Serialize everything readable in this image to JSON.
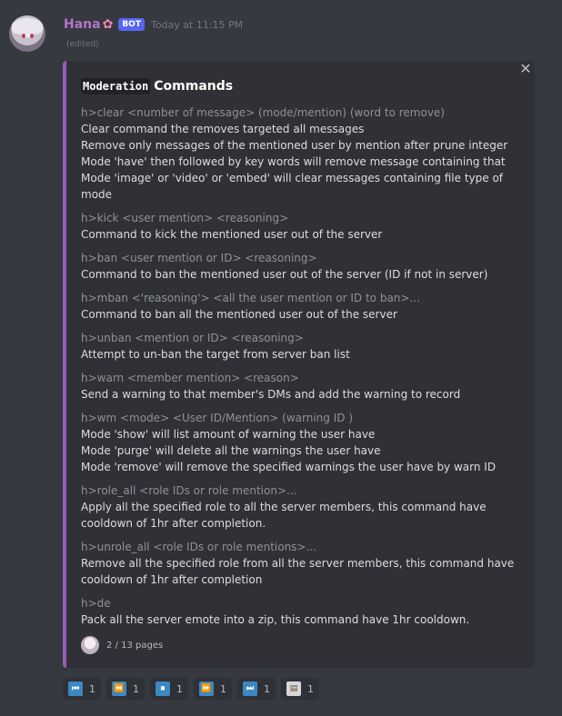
{
  "message": {
    "username": "Hana",
    "bot_tag": "BOT",
    "timestamp": "Today at 11:15 PM",
    "edited": "(edited)"
  },
  "embed": {
    "title_code": "Moderation",
    "title_text": "Commands",
    "accent_color": "#9b59b6",
    "fields": [
      {
        "name": "h>clear <number of message> (mode/mention) (word to remove)",
        "value": "Clear command the removes targeted all messages\nRemove only messages of the mentioned user by mention after prune integer\nMode 'have' then followed by key words will remove message containing that\nMode 'image' or 'video' or 'embed' will clear messages containing file type of mode"
      },
      {
        "name": "h>kick <user mention> <reasoning>",
        "value": "Command to kick the mentioned user out of the server"
      },
      {
        "name": "h>ban <user mention or ID> <reasoning>",
        "value": "Command to ban the mentioned user out of the server (ID if not in server)"
      },
      {
        "name": "h>mban <'reasoning'> <all the user mention or ID to ban>...",
        "value": "Command to ban all the mentioned user out of the server"
      },
      {
        "name": "h>unban <mention or ID> <reasoning>",
        "value": "Attempt to un-ban the target from server ban list"
      },
      {
        "name": "h>warn <member mention> <reason>",
        "value": "Send a warning to that member's DMs and add the warning to record"
      },
      {
        "name": "h>wm <mode> <User ID/Mention> (warning ID )",
        "value": "Mode 'show' will list amount of warning the user have\nMode 'purge' will delete all the warnings the user have\nMode 'remove' will remove the specified warnings the user have by warn ID"
      },
      {
        "name": "h>role_all <role IDs or role mention>...",
        "value": "Apply all the specified role to all the server members, this command have\ncooldown of 1hr after completion."
      },
      {
        "name": "h>unrole_all <role IDs or role mentions>...",
        "value": "Remove all the specified role from all the server members, this command have\ncooldown of 1hr after completion"
      },
      {
        "name": "h>de",
        "value": "Pack all the server emote into a zip, this command have 1hr cooldown."
      }
    ],
    "footer": "2 / 13 pages"
  },
  "reactions": [
    {
      "icon": "first-page-icon",
      "glyph": "⏮",
      "count": "1"
    },
    {
      "icon": "previous-page-icon",
      "glyph": "⏪",
      "count": "1"
    },
    {
      "icon": "stop-icon",
      "glyph": "⏹",
      "count": "1"
    },
    {
      "icon": "next-page-icon",
      "glyph": "⏩",
      "count": "1"
    },
    {
      "icon": "last-page-icon",
      "glyph": "⏭",
      "count": "1"
    },
    {
      "icon": "clipboard-icon",
      "glyph": "📋",
      "count": "1"
    }
  ]
}
